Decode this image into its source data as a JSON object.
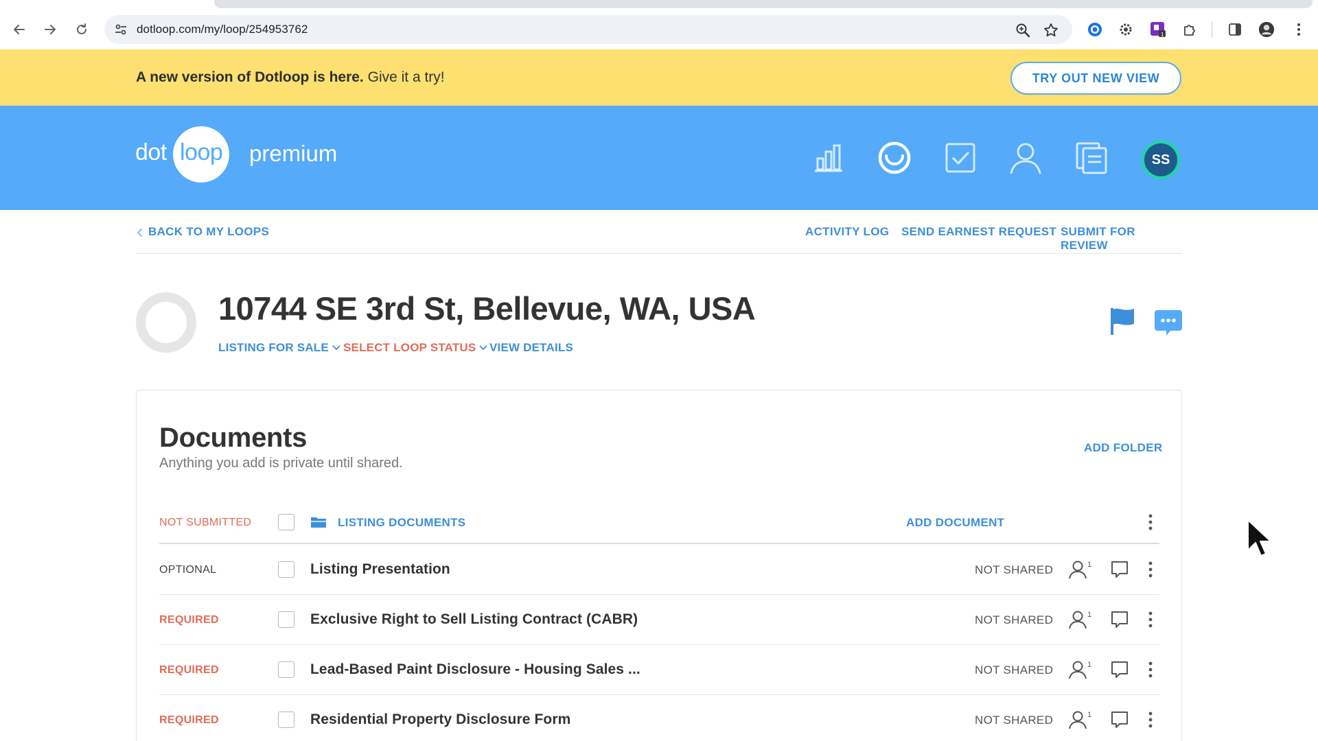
{
  "browser": {
    "url": "dotloop.com/my/loop/254953762",
    "icons": [
      "back-arrow-icon",
      "forward-arrow-icon",
      "reload-icon",
      "site-settings-icon",
      "zoom-icon",
      "bookmark-star-icon",
      "extension-icons",
      "side-panel-icon",
      "profile-avatar",
      "kebab-menu-icon"
    ]
  },
  "banner": {
    "bold_text": "A new version of Dotloop is here.",
    "text": "Give it a try!",
    "button_label": "TRY OUT NEW VIEW",
    "background_color": "#fde06f"
  },
  "header": {
    "logo_left": "dot",
    "logo_circle_text": "loop",
    "logo_suffix": "premium",
    "avatar_initials": "SS",
    "background_color": "#55aaf9",
    "nav_icons": [
      "reports-chart-icon",
      "loops-circle-icon",
      "tasks-check-icon",
      "people-icon",
      "templates-docs-icon"
    ]
  },
  "subnav": {
    "back_label": "BACK TO MY LOOPS",
    "activity_log": "ACTIVITY LOG",
    "send_earnest": "SEND EARNEST REQUEST",
    "submit_review": "SUBMIT FOR REVIEW"
  },
  "loop": {
    "title": "10744 SE 3rd St, Bellevue, WA, USA",
    "transaction_type": "LISTING FOR SALE",
    "status_select": "SELECT LOOP STATUS",
    "view_details": "VIEW DETAILS"
  },
  "documents": {
    "title": "Documents",
    "subtitle": "Anything you add is private until shared.",
    "add_folder": "ADD FOLDER",
    "folder": {
      "status": "NOT SUBMITTED",
      "name": "LISTING DOCUMENTS",
      "add_document": "ADD DOCUMENT"
    },
    "rows": [
      {
        "status": "OPTIONAL",
        "name": "Listing Presentation",
        "share": "NOT SHARED",
        "people_count": "1"
      },
      {
        "status": "REQUIRED",
        "name": "Exclusive Right to Sell Listing Contract (CABR)",
        "share": "NOT SHARED",
        "people_count": "1"
      },
      {
        "status": "REQUIRED",
        "name": "Lead-Based Paint Disclosure - Housing Sales ...",
        "share": "NOT SHARED",
        "people_count": "1"
      },
      {
        "status": "REQUIRED",
        "name": "Residential Property Disclosure Form",
        "share": "NOT SHARED",
        "people_count": "1"
      }
    ]
  }
}
